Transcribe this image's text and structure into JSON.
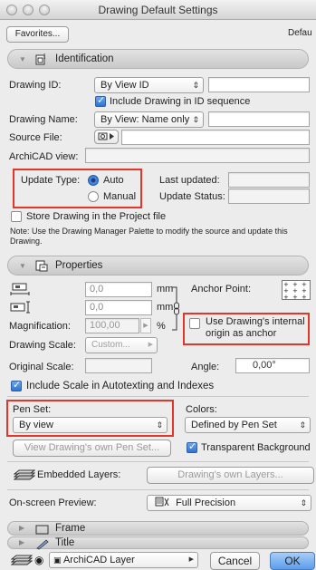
{
  "window": {
    "title": "Drawing Default Settings"
  },
  "toolbar": {
    "favorites_label": "Favorites...",
    "default_label": "Defau"
  },
  "identification": {
    "section_label": "Identification",
    "drawing_id_label": "Drawing ID:",
    "drawing_id_value": "By View ID",
    "include_id_label": "Include Drawing in ID sequence",
    "drawing_name_label": "Drawing Name:",
    "drawing_name_value": "By View: Name only",
    "source_file_label": "Source File:",
    "archicad_view_label": "ArchiCAD view:",
    "update_type_label": "Update Type:",
    "auto_label": "Auto",
    "manual_label": "Manual",
    "last_updated_label": "Last updated:",
    "update_status_label": "Update Status:",
    "store_drawing_label": "Store Drawing in the Project file",
    "note_text": "Note:  Use the Drawing Manager Palette to modify the source and update this Drawing."
  },
  "properties": {
    "section_label": "Properties",
    "width_value": "0,0",
    "height_value": "0,0",
    "unit_mm": "mm",
    "anchor_point_label": "Anchor Point:",
    "magnification_label": "Magnification:",
    "magnification_value": "100,00",
    "percent_label": "%",
    "internal_origin_label": "Use Drawing's internal origin as anchor",
    "drawing_scale_label": "Drawing Scale:",
    "drawing_scale_value": "Custom...",
    "original_scale_label": "Original Scale:",
    "angle_label": "Angle:",
    "angle_value": "0,00°",
    "include_scale_label": "Include Scale in Autotexting and Indexes",
    "pen_set_label": "Pen Set:",
    "pen_set_value": "By view",
    "colors_label": "Colors:",
    "colors_value": "Defined by Pen Set",
    "view_pen_set_label": "View Drawing's own Pen Set...",
    "transparent_bg_label": "Transparent Background",
    "embedded_layers_label": "Embedded Layers:",
    "own_layers_label": "Drawing's own Layers...",
    "onscreen_preview_label": "On-screen Preview:",
    "onscreen_preview_value": "Full Precision"
  },
  "frame": {
    "section_label": "Frame"
  },
  "title": {
    "section_label": "Title"
  },
  "footer": {
    "layer_value": "ArchiCAD Layer",
    "cancel_label": "Cancel",
    "ok_label": "OK"
  },
  "colors": {
    "highlight_red": "#e4352b",
    "accent_blue": "#2f73d4"
  }
}
